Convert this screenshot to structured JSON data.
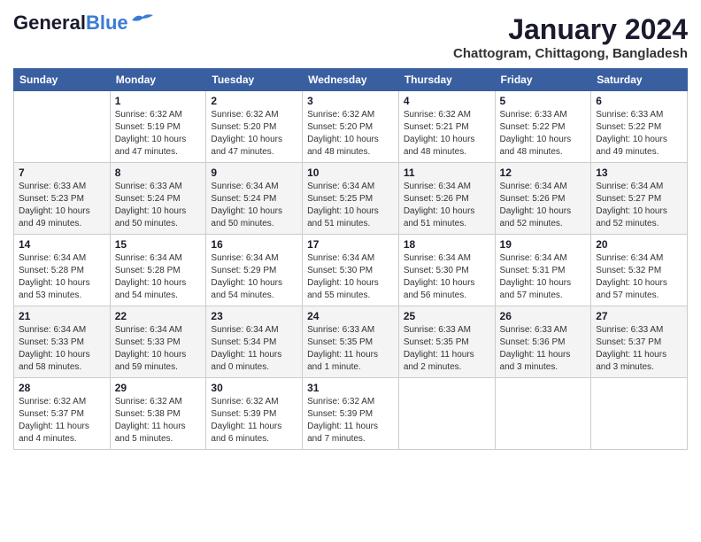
{
  "header": {
    "logo_general": "General",
    "logo_blue": "Blue",
    "month_year": "January 2024",
    "location": "Chattogram, Chittagong, Bangladesh"
  },
  "days_of_week": [
    "Sunday",
    "Monday",
    "Tuesday",
    "Wednesday",
    "Thursday",
    "Friday",
    "Saturday"
  ],
  "weeks": [
    [
      {
        "day": "",
        "sunrise": "",
        "sunset": "",
        "daylight": ""
      },
      {
        "day": "1",
        "sunrise": "Sunrise: 6:32 AM",
        "sunset": "Sunset: 5:19 PM",
        "daylight": "Daylight: 10 hours and 47 minutes."
      },
      {
        "day": "2",
        "sunrise": "Sunrise: 6:32 AM",
        "sunset": "Sunset: 5:20 PM",
        "daylight": "Daylight: 10 hours and 47 minutes."
      },
      {
        "day": "3",
        "sunrise": "Sunrise: 6:32 AM",
        "sunset": "Sunset: 5:20 PM",
        "daylight": "Daylight: 10 hours and 48 minutes."
      },
      {
        "day": "4",
        "sunrise": "Sunrise: 6:32 AM",
        "sunset": "Sunset: 5:21 PM",
        "daylight": "Daylight: 10 hours and 48 minutes."
      },
      {
        "day": "5",
        "sunrise": "Sunrise: 6:33 AM",
        "sunset": "Sunset: 5:22 PM",
        "daylight": "Daylight: 10 hours and 48 minutes."
      },
      {
        "day": "6",
        "sunrise": "Sunrise: 6:33 AM",
        "sunset": "Sunset: 5:22 PM",
        "daylight": "Daylight: 10 hours and 49 minutes."
      }
    ],
    [
      {
        "day": "7",
        "sunrise": "Sunrise: 6:33 AM",
        "sunset": "Sunset: 5:23 PM",
        "daylight": "Daylight: 10 hours and 49 minutes."
      },
      {
        "day": "8",
        "sunrise": "Sunrise: 6:33 AM",
        "sunset": "Sunset: 5:24 PM",
        "daylight": "Daylight: 10 hours and 50 minutes."
      },
      {
        "day": "9",
        "sunrise": "Sunrise: 6:34 AM",
        "sunset": "Sunset: 5:24 PM",
        "daylight": "Daylight: 10 hours and 50 minutes."
      },
      {
        "day": "10",
        "sunrise": "Sunrise: 6:34 AM",
        "sunset": "Sunset: 5:25 PM",
        "daylight": "Daylight: 10 hours and 51 minutes."
      },
      {
        "day": "11",
        "sunrise": "Sunrise: 6:34 AM",
        "sunset": "Sunset: 5:26 PM",
        "daylight": "Daylight: 10 hours and 51 minutes."
      },
      {
        "day": "12",
        "sunrise": "Sunrise: 6:34 AM",
        "sunset": "Sunset: 5:26 PM",
        "daylight": "Daylight: 10 hours and 52 minutes."
      },
      {
        "day": "13",
        "sunrise": "Sunrise: 6:34 AM",
        "sunset": "Sunset: 5:27 PM",
        "daylight": "Daylight: 10 hours and 52 minutes."
      }
    ],
    [
      {
        "day": "14",
        "sunrise": "Sunrise: 6:34 AM",
        "sunset": "Sunset: 5:28 PM",
        "daylight": "Daylight: 10 hours and 53 minutes."
      },
      {
        "day": "15",
        "sunrise": "Sunrise: 6:34 AM",
        "sunset": "Sunset: 5:28 PM",
        "daylight": "Daylight: 10 hours and 54 minutes."
      },
      {
        "day": "16",
        "sunrise": "Sunrise: 6:34 AM",
        "sunset": "Sunset: 5:29 PM",
        "daylight": "Daylight: 10 hours and 54 minutes."
      },
      {
        "day": "17",
        "sunrise": "Sunrise: 6:34 AM",
        "sunset": "Sunset: 5:30 PM",
        "daylight": "Daylight: 10 hours and 55 minutes."
      },
      {
        "day": "18",
        "sunrise": "Sunrise: 6:34 AM",
        "sunset": "Sunset: 5:30 PM",
        "daylight": "Daylight: 10 hours and 56 minutes."
      },
      {
        "day": "19",
        "sunrise": "Sunrise: 6:34 AM",
        "sunset": "Sunset: 5:31 PM",
        "daylight": "Daylight: 10 hours and 57 minutes."
      },
      {
        "day": "20",
        "sunrise": "Sunrise: 6:34 AM",
        "sunset": "Sunset: 5:32 PM",
        "daylight": "Daylight: 10 hours and 57 minutes."
      }
    ],
    [
      {
        "day": "21",
        "sunrise": "Sunrise: 6:34 AM",
        "sunset": "Sunset: 5:33 PM",
        "daylight": "Daylight: 10 hours and 58 minutes."
      },
      {
        "day": "22",
        "sunrise": "Sunrise: 6:34 AM",
        "sunset": "Sunset: 5:33 PM",
        "daylight": "Daylight: 10 hours and 59 minutes."
      },
      {
        "day": "23",
        "sunrise": "Sunrise: 6:34 AM",
        "sunset": "Sunset: 5:34 PM",
        "daylight": "Daylight: 11 hours and 0 minutes."
      },
      {
        "day": "24",
        "sunrise": "Sunrise: 6:33 AM",
        "sunset": "Sunset: 5:35 PM",
        "daylight": "Daylight: 11 hours and 1 minute."
      },
      {
        "day": "25",
        "sunrise": "Sunrise: 6:33 AM",
        "sunset": "Sunset: 5:35 PM",
        "daylight": "Daylight: 11 hours and 2 minutes."
      },
      {
        "day": "26",
        "sunrise": "Sunrise: 6:33 AM",
        "sunset": "Sunset: 5:36 PM",
        "daylight": "Daylight: 11 hours and 3 minutes."
      },
      {
        "day": "27",
        "sunrise": "Sunrise: 6:33 AM",
        "sunset": "Sunset: 5:37 PM",
        "daylight": "Daylight: 11 hours and 3 minutes."
      }
    ],
    [
      {
        "day": "28",
        "sunrise": "Sunrise: 6:32 AM",
        "sunset": "Sunset: 5:37 PM",
        "daylight": "Daylight: 11 hours and 4 minutes."
      },
      {
        "day": "29",
        "sunrise": "Sunrise: 6:32 AM",
        "sunset": "Sunset: 5:38 PM",
        "daylight": "Daylight: 11 hours and 5 minutes."
      },
      {
        "day": "30",
        "sunrise": "Sunrise: 6:32 AM",
        "sunset": "Sunset: 5:39 PM",
        "daylight": "Daylight: 11 hours and 6 minutes."
      },
      {
        "day": "31",
        "sunrise": "Sunrise: 6:32 AM",
        "sunset": "Sunset: 5:39 PM",
        "daylight": "Daylight: 11 hours and 7 minutes."
      },
      {
        "day": "",
        "sunrise": "",
        "sunset": "",
        "daylight": ""
      },
      {
        "day": "",
        "sunrise": "",
        "sunset": "",
        "daylight": ""
      },
      {
        "day": "",
        "sunrise": "",
        "sunset": "",
        "daylight": ""
      }
    ]
  ]
}
